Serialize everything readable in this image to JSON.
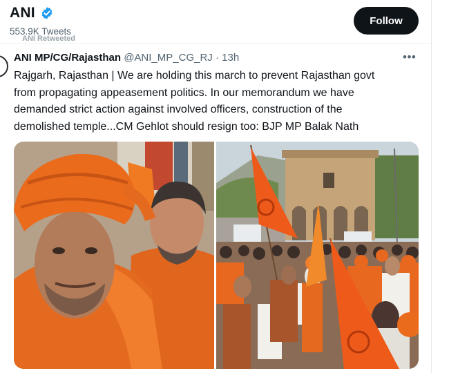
{
  "profile": {
    "name": "ANI",
    "tweets_count": "553.9K Tweets",
    "follow_label": "Follow"
  },
  "tweet": {
    "retweet_label": "ANI Retweeted",
    "author_name": "ANI MP/CG/Rajasthan",
    "handle": "@ANI_MP_CG_RJ",
    "separator": "·",
    "time": "13h",
    "text": "Rajgarh, Rajasthan | We are holding this march to prevent Rajasthan govt\nfrom propagating appeasement politics. In our memorandum we have\ndemanded strict  action against involved officers, construction of the\ndemolished temple...CM Gehlot should resign too: BJP MP Balak Nath",
    "more_icon": "more-horizontal-icon"
  },
  "media": {
    "photos": [
      "march-photo-closeup",
      "march-photo-procession"
    ]
  },
  "colors": {
    "follow_bg": "#0f1419",
    "verified": "#1d9bf0",
    "muted": "#536471",
    "saffron": "#e86a1c"
  }
}
